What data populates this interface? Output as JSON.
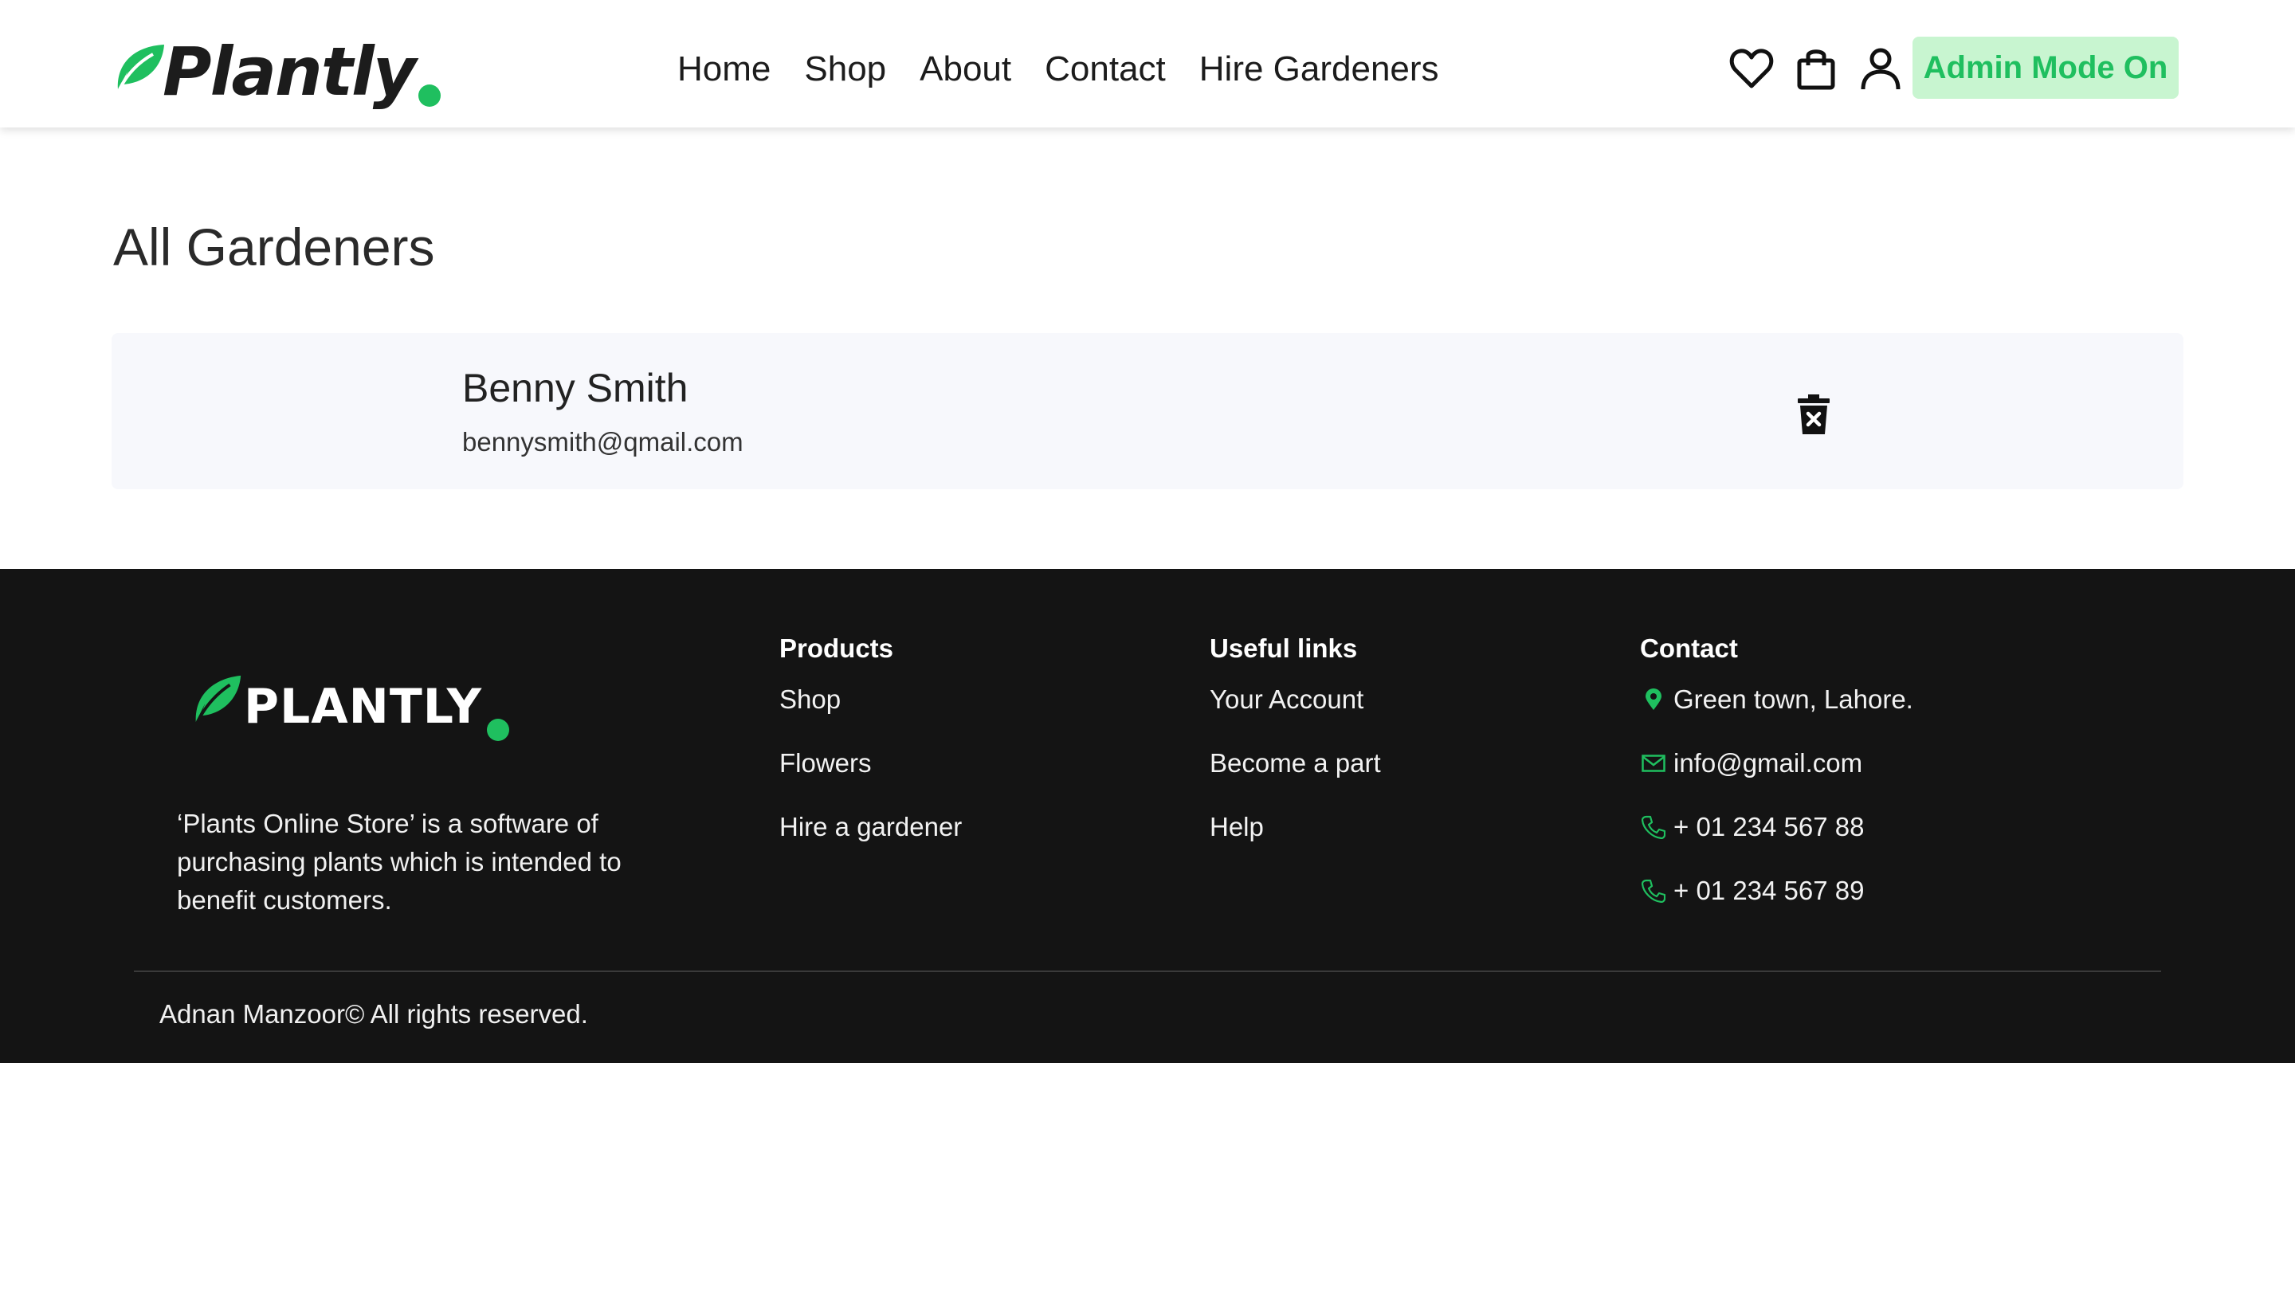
{
  "colors": {
    "brand_green": "#1fbf5f",
    "admin_bg": "#c8f5d0",
    "admin_text": "#1fbf5f",
    "footer_bg": "#141414",
    "card_bg": "#f7f8fc"
  },
  "header": {
    "logo_text": "Plantly",
    "nav": [
      "Home",
      "Shop",
      "About",
      "Contact",
      "Hire Gardeners"
    ],
    "icons": [
      "heart-icon",
      "shopping-bag-icon",
      "user-icon"
    ],
    "admin_label": "Admin Mode On"
  },
  "main": {
    "title": "All Gardeners",
    "gardeners": [
      {
        "name": "Benny Smith",
        "email": "bennysmith@qmail.com"
      }
    ],
    "delete_icon": "trash-icon"
  },
  "footer": {
    "logo_text": "PLANTLY",
    "description": "‘Plants Online Store’ is a software of purchasing plants which is intended to benefit customers.",
    "products": {
      "heading": "Products",
      "links": [
        "Shop",
        "Flowers",
        "Hire a gardener"
      ]
    },
    "useful": {
      "heading": "Useful links",
      "links": [
        "Your Account",
        "Become a part",
        "Help"
      ]
    },
    "contact": {
      "heading": "Contact",
      "address": "Green town, Lahore.",
      "email": "info@gmail.com",
      "phone1": "+ 01 234 567 88",
      "phone2": "+ 01 234 567 89"
    },
    "copyright": "Adnan Manzoor© All rights reserved."
  }
}
